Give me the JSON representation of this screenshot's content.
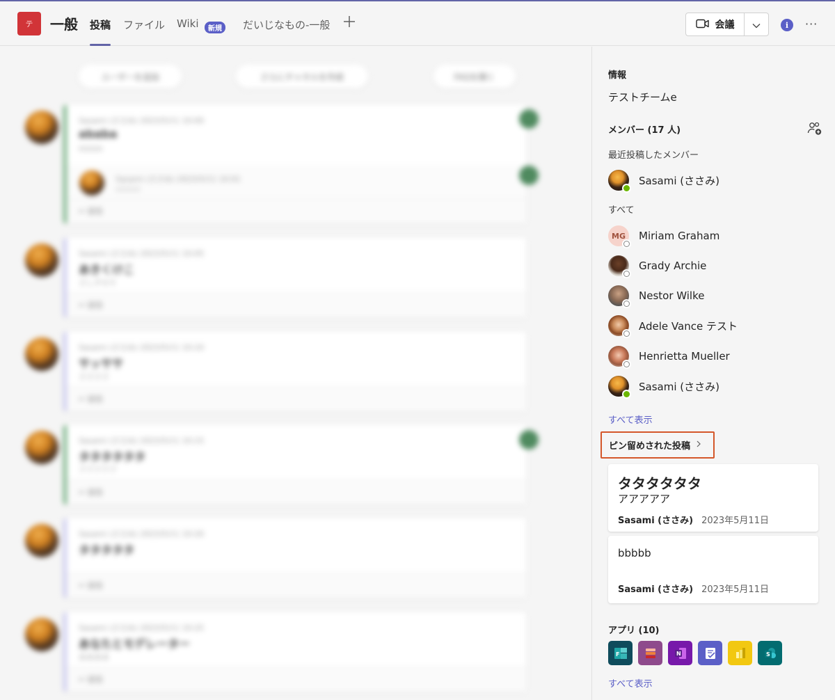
{
  "header": {
    "team_initial": "テ",
    "channel_name": "一般",
    "tabs": [
      {
        "label": "投稿"
      },
      {
        "label": "ファイル"
      },
      {
        "label": "Wiki"
      },
      {
        "label": "だいじなもの-一般"
      }
    ],
    "new_badge": "新規",
    "meet_label": "会議",
    "info_icon": "i",
    "more_icon": "···"
  },
  "feed": {
    "pills": [
      "ユーザーを追加",
      "さらにチャネルを作成",
      "FAQを開く"
    ],
    "posts": [
      {
        "meta": "Sasami (ささみ)   2023/5/11 10:00",
        "title": "ababa",
        "sub": "bbbbb",
        "reply": "↩ 返信",
        "bar": "#6fae7e"
      },
      {
        "meta": "Sasami (ささみ)   2023/5/11 10:05",
        "title": "あきくけこ",
        "sub": "さしすせそ",
        "reply": "↩ 返信",
        "bar": "#c9c8ef"
      },
      {
        "meta": "Sasami (ささみ)   2023/5/11 10:10",
        "title": "サッササ",
        "sub": "ささささ",
        "reply": "↩ 返信",
        "bar": "#c9c8ef"
      },
      {
        "meta": "Sasami (ささみ)   2023/5/11 10:15",
        "title": "タタタタタタ",
        "sub": "アアアアア",
        "reply": "↩ 返信",
        "bar": "#6fae7e"
      },
      {
        "meta": "Sasami (ささみ)   2023/5/11 10:20",
        "title": "タタタタタ",
        "sub": "",
        "reply": "↩ 返信",
        "bar": "#c9c8ef"
      },
      {
        "meta": "Sasami (ささみ)   2023/5/11 10:25",
        "title": "あなたとモデレーター",
        "sub": "ああああ",
        "reply": "↩ 返信",
        "bar": "#c9c8ef"
      }
    ],
    "nested_reply": {
      "meta": "Sasami (ささみ)   2023/5/11 10:01",
      "text": "cccccc"
    }
  },
  "panel": {
    "info_title": "情報",
    "team_name": "テストチームe",
    "members_title": "メンバー (17 人)",
    "recent_label": "最近投稿したメンバー",
    "recent_member": {
      "name": "Sasami (ささみ)",
      "status": "available"
    },
    "all_label": "すべて",
    "members": [
      {
        "name": "Miriam Graham",
        "initials": "MG",
        "status": "offline"
      },
      {
        "name": "Grady Archie",
        "initials": "",
        "status": "offline"
      },
      {
        "name": "Nestor Wilke",
        "initials": "",
        "status": "offline"
      },
      {
        "name": "Adele Vance テスト",
        "initials": "",
        "status": "offline"
      },
      {
        "name": "Henrietta Mueller",
        "initials": "",
        "status": "offline"
      },
      {
        "name": "Sasami (ささみ)",
        "initials": "",
        "status": "available"
      }
    ],
    "show_all": "すべて表示",
    "pinned_title": "ピン留めされた投稿",
    "pinned_posts": [
      {
        "title": "タタタタタタ",
        "body": "アアアアア",
        "author": "Sasami (ささみ)",
        "date": "2023年5月11日"
      },
      {
        "title": "",
        "body": "bbbbb",
        "author": "Sasami (ささみ)",
        "date": "2023年5月11日"
      }
    ],
    "apps_title": "アプリ (10)",
    "apps": [
      {
        "name": "forms-icon",
        "color": "#0f4c5c"
      },
      {
        "name": "stream-icon",
        "color": "#8e4a8c"
      },
      {
        "name": "onenote-icon",
        "color": "#7719aa"
      },
      {
        "name": "tasks-icon",
        "color": "#5b5fc7"
      },
      {
        "name": "powerbi-icon",
        "color": "#f2c811"
      },
      {
        "name": "sharepoint-icon",
        "color": "#036c70"
      }
    ],
    "apps_show_all": "すべて表示"
  }
}
